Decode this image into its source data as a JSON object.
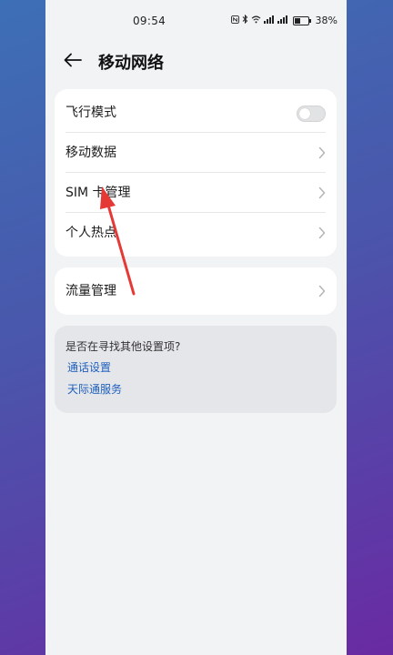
{
  "status_bar": {
    "time": "09:54",
    "battery_text": "38%"
  },
  "header": {
    "title": "移动网络"
  },
  "settings_group_1": {
    "items": [
      {
        "label": "飞行模式",
        "control": "toggle",
        "toggle_on": false
      },
      {
        "label": "移动数据",
        "control": "chevron"
      },
      {
        "label": "SIM 卡管理",
        "control": "chevron"
      },
      {
        "label": "个人热点",
        "control": "chevron"
      }
    ]
  },
  "settings_group_2": {
    "items": [
      {
        "label": "流量管理",
        "control": "chevron"
      }
    ]
  },
  "suggestions": {
    "question": "是否在寻找其他设置项?",
    "links": [
      "通话设置",
      "天际通服务"
    ]
  },
  "colors": {
    "link": "#1f5fbd",
    "annotation_arrow": "#e53935"
  }
}
